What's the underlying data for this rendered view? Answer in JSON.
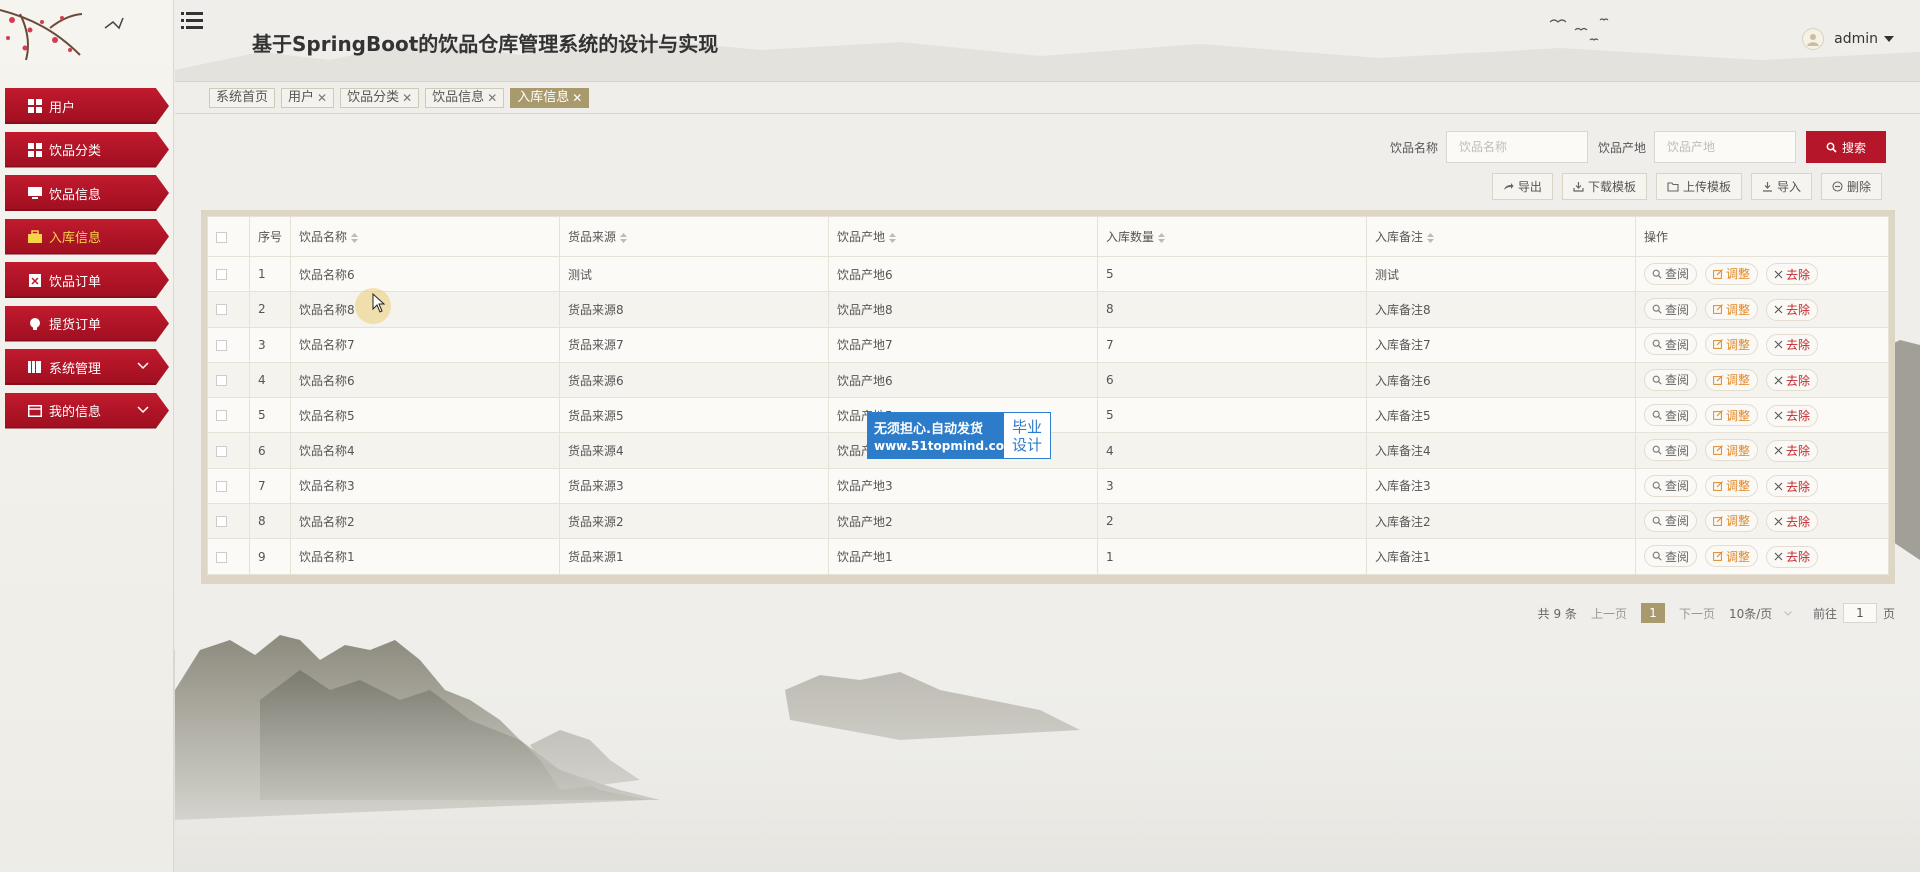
{
  "app": {
    "title": "基于SpringBoot的饮品仓库管理系统的设计与实现"
  },
  "user": {
    "name": "admin"
  },
  "colors": {
    "primary_red": "#b5162a",
    "tab_active": "#a89a6c",
    "edit_orange": "#e08a2b",
    "delete_red": "#c1272d"
  },
  "sidebar": {
    "items": [
      {
        "label": "用户",
        "icon": "grid-icon",
        "active": false
      },
      {
        "label": "饮品分类",
        "icon": "grid-icon",
        "active": false
      },
      {
        "label": "饮品信息",
        "icon": "monitor-icon",
        "active": false
      },
      {
        "label": "入库信息",
        "icon": "briefcase-icon",
        "active": true
      },
      {
        "label": "饮品订单",
        "icon": "clipboard-icon",
        "active": false
      },
      {
        "label": "提货订单",
        "icon": "lightbulb-icon",
        "active": false
      },
      {
        "label": "系统管理",
        "icon": "books-icon",
        "active": false,
        "expandable": true
      },
      {
        "label": "我的信息",
        "icon": "card-icon",
        "active": false,
        "expandable": true
      }
    ]
  },
  "tabs": [
    {
      "label": "系统首页",
      "closable": false,
      "active": false
    },
    {
      "label": "用户",
      "closable": true,
      "active": false
    },
    {
      "label": "饮品分类",
      "closable": true,
      "active": false
    },
    {
      "label": "饮品信息",
      "closable": true,
      "active": false
    },
    {
      "label": "入库信息",
      "closable": true,
      "active": true
    }
  ],
  "search": {
    "name_label": "饮品名称",
    "name_placeholder": "饮品名称",
    "origin_label": "饮品产地",
    "origin_placeholder": "饮品产地",
    "button_label": "搜索"
  },
  "toolbar": {
    "export": "导出",
    "download_template": "下载模板",
    "upload_template": "上传模板",
    "import": "导入",
    "delete": "删除"
  },
  "table": {
    "headers": [
      "序号",
      "饮品名称",
      "货品来源",
      "饮品产地",
      "入库数量",
      "入库备注",
      "操作"
    ],
    "actions": {
      "view": "查阅",
      "edit": "调整",
      "delete": "去除"
    },
    "rows": [
      [
        "1",
        "饮品名称6",
        "测试",
        "饮品产地6",
        "5",
        "测试"
      ],
      [
        "2",
        "饮品名称8",
        "货品来源8",
        "饮品产地8",
        "8",
        "入库备注8"
      ],
      [
        "3",
        "饮品名称7",
        "货品来源7",
        "饮品产地7",
        "7",
        "入库备注7"
      ],
      [
        "4",
        "饮品名称6",
        "货品来源6",
        "饮品产地6",
        "6",
        "入库备注6"
      ],
      [
        "5",
        "饮品名称5",
        "货品来源5",
        "饮品产地5",
        "5",
        "入库备注5"
      ],
      [
        "6",
        "饮品名称4",
        "货品来源4",
        "饮品产地4",
        "4",
        "入库备注4"
      ],
      [
        "7",
        "饮品名称3",
        "货品来源3",
        "饮品产地3",
        "3",
        "入库备注3"
      ],
      [
        "8",
        "饮品名称2",
        "货品来源2",
        "饮品产地2",
        "2",
        "入库备注2"
      ],
      [
        "9",
        "饮品名称1",
        "货品来源1",
        "饮品产地1",
        "1",
        "入库备注1"
      ]
    ]
  },
  "watermark": {
    "line1": "无须担心.自动发货",
    "line2": "www.51topmind.com",
    "right_top": "毕业",
    "right_bottom": "设计"
  },
  "pagination": {
    "total": "共 9 条",
    "prev": "上一页",
    "current": "1",
    "next": "下一页",
    "page_size": "10条/页",
    "goto_prefix": "前往",
    "goto_value": "1",
    "goto_suffix": "页"
  }
}
